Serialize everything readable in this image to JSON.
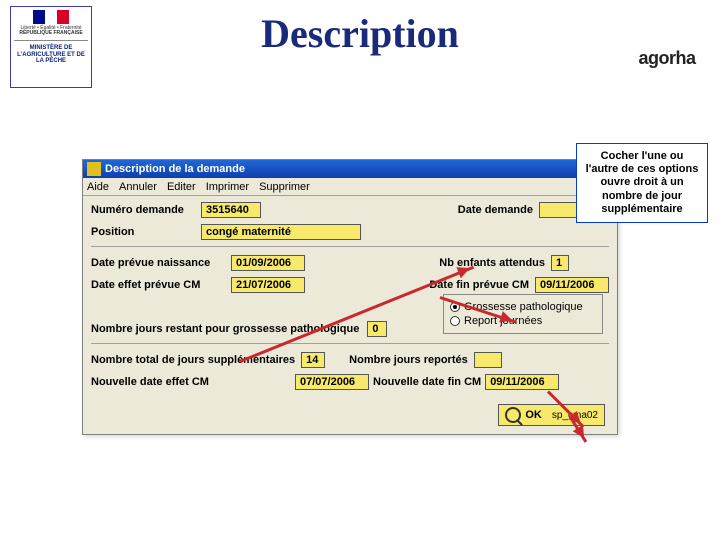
{
  "header": {
    "title": "Description",
    "ministry": {
      "rf": "Liberté • Égalité • Fraternité",
      "rep": "RÉPUBLIQUE FRANÇAISE",
      "name": "MINISTÈRE DE L'AGRICULTURE ET DE LA PÊCHE"
    },
    "logo_text": "agorha"
  },
  "dialog": {
    "title": "Description de la demande",
    "menu": [
      "Aide",
      "Annuler",
      "Editer",
      "Imprimer",
      "Supprimer"
    ],
    "fields": {
      "numero_demande_label": "Numéro demande",
      "numero_demande_value": "3515640",
      "date_demande_label": "Date demande",
      "date_demande_value": "",
      "position_label": "Position",
      "position_value": "congé maternité",
      "date_prevue_naissance_label": "Date prévue naissance",
      "date_prevue_naissance_value": "01/09/2006",
      "nb_enfants_label": "Nb enfants attendus",
      "nb_enfants_value": "1",
      "date_effet_prevue_label": "Date effet prévue CM",
      "date_effet_prevue_value": "21/07/2006",
      "date_fin_prevue_label": "Date fin prévue CM",
      "date_fin_prevue_value": "09/11/2006",
      "nb_jours_restant_label": "Nombre jours restant pour grossesse pathologique",
      "nb_jours_restant_value": "0",
      "nb_total_supp_label": "Nombre total de jours supplémentaires",
      "nb_total_supp_value": "14",
      "nb_jours_reportes_label": "Nombre jours reportés",
      "nb_jours_reportes_value": "",
      "nouvelle_date_effet_label": "Nouvelle date effet CM",
      "nouvelle_date_effet_value": "07/07/2006",
      "nouvelle_date_fin_label": "Nouvelle date fin CM",
      "nouvelle_date_fin_value": "09/11/2006"
    },
    "radio": {
      "option1": "Grossesse pathologique",
      "option2": "Report journées",
      "selected": 1
    },
    "ok": {
      "label": "OK",
      "code": "sp_cma02"
    }
  },
  "callout": {
    "text": "Cocher l'une ou l'autre de ces options ouvre droit à un nombre de jour supplémentaire"
  }
}
